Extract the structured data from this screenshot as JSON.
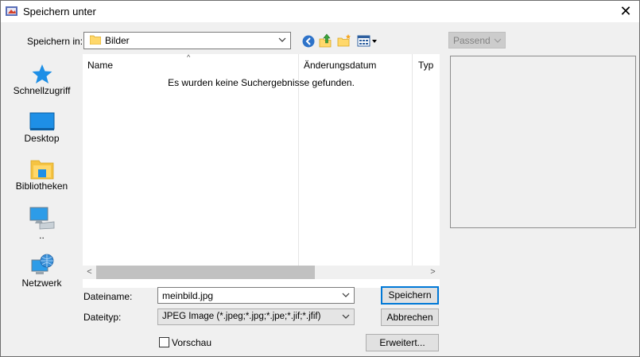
{
  "window": {
    "title": "Speichern unter",
    "close_glyph": "✕"
  },
  "save_in": {
    "label": "Speichern in:",
    "value": "Bilder"
  },
  "toolbar": {
    "icons": [
      "back-icon",
      "up-folder-icon",
      "new-folder-icon",
      "view-menu-icon"
    ]
  },
  "sidebar": {
    "places": [
      {
        "label": "Schnellzugriff",
        "icon": "quick-access-star-icon"
      },
      {
        "label": "Desktop",
        "icon": "desktop-icon"
      },
      {
        "label": "Bibliotheken",
        "icon": "libraries-icon"
      },
      {
        "label": "..",
        "icon": "this-pc-icon"
      },
      {
        "label": "Netzwerk",
        "icon": "network-icon"
      }
    ]
  },
  "file_list": {
    "columns": [
      "Name",
      "Änderungsdatum",
      "Typ"
    ],
    "sort_indicator": "^",
    "empty_message": "Es wurden keine Suchergebnisse gefunden."
  },
  "filename": {
    "label": "Dateiname:",
    "value": "meinbild.jpg"
  },
  "filetype": {
    "label": "Dateityp:",
    "value": "JPEG Image (*.jpeg;*.jpg;*.jpe;*.jif;*.jfif)"
  },
  "buttons": {
    "save": "Speichern",
    "cancel": "Abbrechen",
    "advanced": "Erweitert..."
  },
  "preview": {
    "checkbox_label": "Vorschau",
    "checked": false,
    "fit_select": "Passend"
  },
  "colors": {
    "accent": "#0078d7",
    "folder": "#ffd86b"
  }
}
